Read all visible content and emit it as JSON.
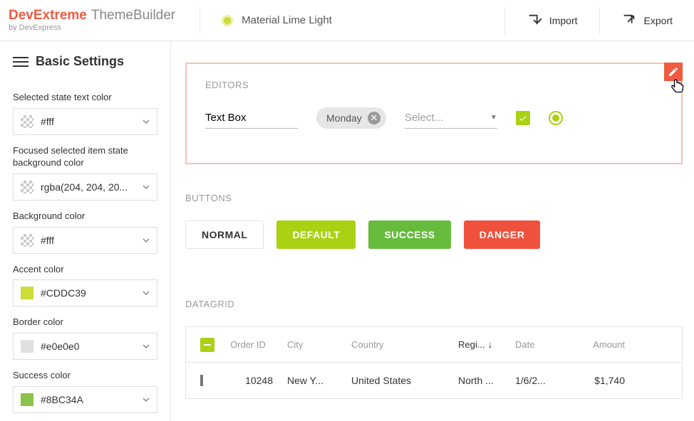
{
  "header": {
    "brand_primary": "DevExtreme",
    "brand_secondary": "ThemeBuilder",
    "brand_sub": "by DevExpress",
    "theme_name": "Material Lime Light",
    "import_label": "Import",
    "export_label": "Export"
  },
  "sidebar": {
    "title": "Basic Settings",
    "settings": [
      {
        "label": "Selected state text color",
        "value": "#fff",
        "swatch": "#ffffff",
        "checker": true
      },
      {
        "label": "Focused selected item state background color",
        "value": "rgba(204, 204, 20...",
        "swatch": "#cccccc",
        "checker": true
      },
      {
        "label": "Background color",
        "value": "#fff",
        "swatch": "#ffffff",
        "checker": true
      },
      {
        "label": "Accent color",
        "value": "#CDDC39",
        "swatch": "#cddc39",
        "checker": false
      },
      {
        "label": "Border color",
        "value": "#e0e0e0",
        "swatch": "#e0e0e0",
        "checker": false
      },
      {
        "label": "Success color",
        "value": "#8BC34A",
        "swatch": "#8bc34a",
        "checker": false
      }
    ]
  },
  "preview": {
    "editors": {
      "title": "EDITORS",
      "textbox_value": "Text Box",
      "tag_label": "Monday",
      "select_placeholder": "Select..."
    },
    "buttons": {
      "title": "BUTTONS",
      "normal": "NORMAL",
      "default": "DEFAULT",
      "success": "SUCCESS",
      "danger": "DANGER"
    },
    "datagrid": {
      "title": "DATAGRID",
      "columns": {
        "order_id": "Order ID",
        "city": "City",
        "country": "Country",
        "region": "Regi...",
        "date": "Date",
        "amount": "Amount"
      },
      "rows": [
        {
          "order_id": "10248",
          "city": "New Y...",
          "country": "United States",
          "region": "North ...",
          "date": "1/6/2...",
          "amount": "$1,740"
        }
      ]
    }
  }
}
